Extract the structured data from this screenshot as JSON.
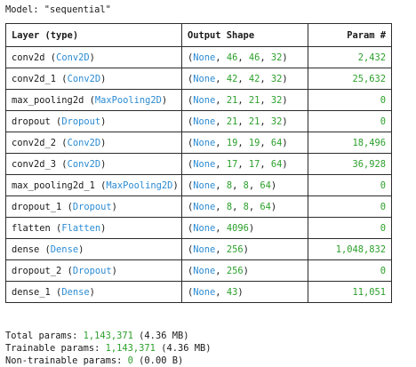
{
  "model_line": "Model: \"sequential\"",
  "headers": {
    "layer": "Layer (type)",
    "shape": "Output Shape",
    "params": "Param #"
  },
  "rows": [
    {
      "name": "conv2d",
      "type": "Conv2D",
      "shape": [
        "None",
        "46",
        "46",
        "32"
      ],
      "params": "2,432"
    },
    {
      "name": "conv2d_1",
      "type": "Conv2D",
      "shape": [
        "None",
        "42",
        "42",
        "32"
      ],
      "params": "25,632"
    },
    {
      "name": "max_pooling2d",
      "type": "MaxPooling2D",
      "shape": [
        "None",
        "21",
        "21",
        "32"
      ],
      "params": "0"
    },
    {
      "name": "dropout",
      "type": "Dropout",
      "shape": [
        "None",
        "21",
        "21",
        "32"
      ],
      "params": "0"
    },
    {
      "name": "conv2d_2",
      "type": "Conv2D",
      "shape": [
        "None",
        "19",
        "19",
        "64"
      ],
      "params": "18,496"
    },
    {
      "name": "conv2d_3",
      "type": "Conv2D",
      "shape": [
        "None",
        "17",
        "17",
        "64"
      ],
      "params": "36,928"
    },
    {
      "name": "max_pooling2d_1",
      "type": "MaxPooling2D",
      "shape": [
        "None",
        "8",
        "8",
        "64"
      ],
      "params": "0"
    },
    {
      "name": "dropout_1",
      "type": "Dropout",
      "shape": [
        "None",
        "8",
        "8",
        "64"
      ],
      "params": "0"
    },
    {
      "name": "flatten",
      "type": "Flatten",
      "shape": [
        "None",
        "4096"
      ],
      "params": "0"
    },
    {
      "name": "dense",
      "type": "Dense",
      "shape": [
        "None",
        "256"
      ],
      "params": "1,048,832"
    },
    {
      "name": "dropout_2",
      "type": "Dropout",
      "shape": [
        "None",
        "256"
      ],
      "params": "0"
    },
    {
      "name": "dense_1",
      "type": "Dense",
      "shape": [
        "None",
        "43"
      ],
      "params": "11,051"
    }
  ],
  "totals": [
    {
      "label": "Total params:",
      "count": "1,143,371",
      "size": "(4.36 MB)"
    },
    {
      "label": "Trainable params:",
      "count": "1,143,371",
      "size": "(4.36 MB)"
    },
    {
      "label": "Non-trainable params:",
      "count": "0",
      "size": "(0.00 B)"
    }
  ],
  "colors": {
    "class_name": "#2a8bd3",
    "number": "#2ca02c",
    "border": "#2b2b2b"
  }
}
